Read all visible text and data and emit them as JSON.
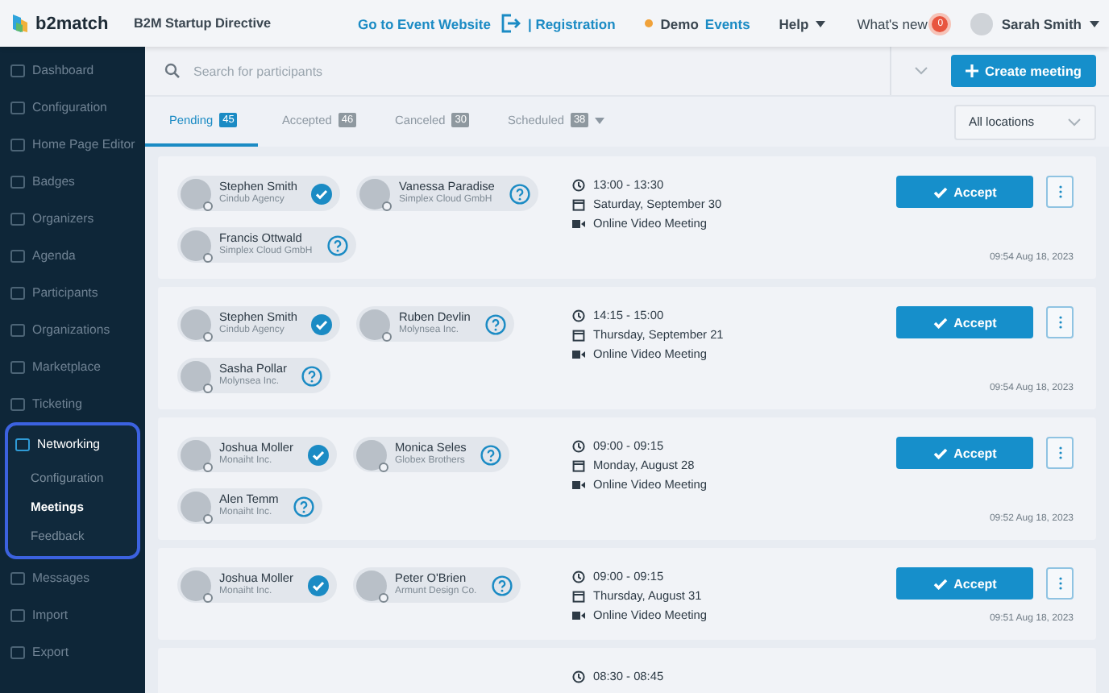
{
  "topbar": {
    "logo": "b2match",
    "event_name": "B2M Startup Directive",
    "links": [
      {
        "kind": "link",
        "label": "Go to Event Website"
      },
      {
        "kind": "link",
        "label": "| Registration"
      },
      {
        "kind": "status",
        "label": "Demo",
        "color": "#f0a23a"
      },
      {
        "kind": "link",
        "label": "Events"
      },
      {
        "kind": "menu",
        "label": "Help"
      },
      {
        "kind": "news",
        "label": "What's new",
        "badge": "0"
      }
    ],
    "user": {
      "name": "Sarah Smith"
    }
  },
  "sidebar": {
    "items": [
      {
        "label": "Dashboard",
        "selected": false
      },
      {
        "label": "Configuration",
        "selected": false
      },
      {
        "label": "Home Page Editor",
        "selected": false
      },
      {
        "label": "Badges",
        "selected": false
      },
      {
        "label": "Organizers",
        "selected": false
      },
      {
        "label": "Agenda",
        "selected": false
      },
      {
        "label": "Participants",
        "selected": false
      },
      {
        "label": "Organizations",
        "selected": false
      },
      {
        "label": "Marketplace",
        "selected": false
      },
      {
        "label": "Ticketing",
        "selected": false
      },
      {
        "label": "Networking",
        "selected": true,
        "highlighted": true,
        "children": [
          {
            "label": "Configuration",
            "selected": false
          },
          {
            "label": "Meetings",
            "selected": true
          },
          {
            "label": "Feedback",
            "selected": false
          }
        ]
      },
      {
        "label": "Messages",
        "selected": false
      },
      {
        "label": "Import",
        "selected": false
      },
      {
        "label": "Export",
        "selected": false
      }
    ]
  },
  "search": {
    "placeholder": "Search for participants"
  },
  "create_button": "Create meeting",
  "tabs": [
    {
      "label": "Pending",
      "count": "45",
      "selected": true
    },
    {
      "label": "Accepted",
      "count": "46",
      "selected": false
    },
    {
      "label": "Canceled",
      "count": "30",
      "selected": false
    },
    {
      "label": "Scheduled",
      "count": "38",
      "selected": false,
      "dropdown": true
    }
  ],
  "location_filter": "All locations",
  "meetings": [
    {
      "people": [
        {
          "name": "Stephen Smith",
          "company": "Cindub Agency",
          "accepted": true
        },
        {
          "name": "Vanessa Paradise",
          "company": "Simplex Cloud GmbH",
          "accepted": false
        },
        {
          "name": "Francis Ottwald",
          "company": "Simplex Cloud GmbH",
          "accepted": false
        }
      ],
      "time": "13:00 - 13:30",
      "date": "Saturday, September 30",
      "location": "Online Video Meeting",
      "accept": "Accept",
      "timestamp": "09:54 Aug 18, 2023"
    },
    {
      "people": [
        {
          "name": "Stephen Smith",
          "company": "Cindub Agency",
          "accepted": true
        },
        {
          "name": "Ruben Devlin",
          "company": "Molynsea Inc.",
          "accepted": false
        },
        {
          "name": "Sasha Pollar",
          "company": "Molynsea Inc.",
          "accepted": false
        }
      ],
      "time": "14:15 - 15:00",
      "date": "Thursday, September 21",
      "location": "Online Video Meeting",
      "accept": "Accept",
      "timestamp": "09:54 Aug 18, 2023"
    },
    {
      "people": [
        {
          "name": "Joshua Moller",
          "company": "Monaiht Inc.",
          "accepted": true
        },
        {
          "name": "Monica Seles",
          "company": "Globex Brothers",
          "accepted": false
        },
        {
          "name": "Alen Temm",
          "company": "Monaiht Inc.",
          "accepted": false
        }
      ],
      "time": "09:00 - 09:15",
      "date": "Monday, August 28",
      "location": "Online Video Meeting",
      "accept": "Accept",
      "timestamp": "09:52 Aug 18, 2023"
    },
    {
      "people": [
        {
          "name": "Joshua Moller",
          "company": "Monaiht Inc.",
          "accepted": true
        },
        {
          "name": "Peter O'Brien",
          "company": "Armunt Design Co.",
          "accepted": false
        }
      ],
      "time": "09:00 - 09:15",
      "date": "Thursday, August 31",
      "location": "Online Video Meeting",
      "accept": "Accept",
      "timestamp": "09:51 Aug 18, 2023"
    },
    {
      "time": "08:30 - 08:45"
    }
  ]
}
